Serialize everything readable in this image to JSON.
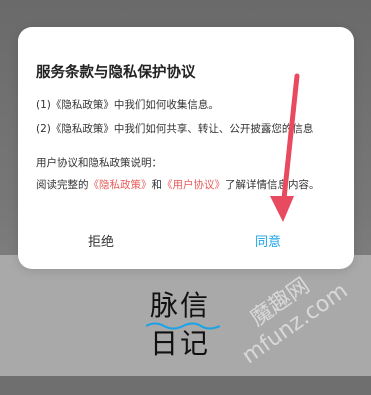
{
  "dialog": {
    "title": "服务条款与隐私保护协议",
    "item1": "(1)《隐私政策》中我们如何收集信息。",
    "item2": "(2)《隐私政策》中我们如何共享、转让、公开披露您的信息",
    "desc_heading": "用户协议和隐私政策说明：",
    "desc_prefix": "阅读完整的",
    "privacy_link": "《隐私政策》",
    "and": "和",
    "user_link": "《用户协议》",
    "desc_suffix": "了解详情信息内容。",
    "reject": "拒绝",
    "agree": "同意"
  },
  "app": {
    "brand_line1": "脉信",
    "brand_line2": "日记"
  },
  "watermark": {
    "line1": "魔趣网",
    "line2": "mfunz.com"
  },
  "colors": {
    "link": "#e85b5b",
    "agree": "#1aa3e8",
    "arrow": "#e84a5f"
  }
}
